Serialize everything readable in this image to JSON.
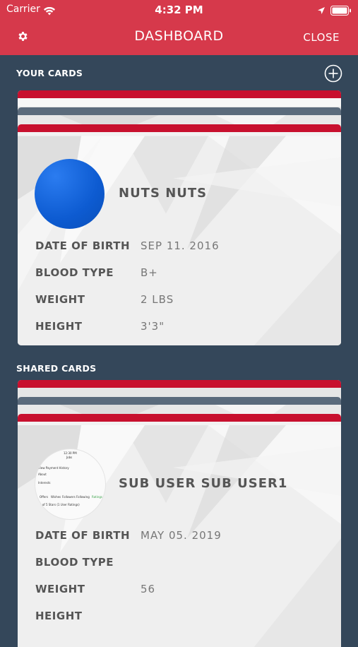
{
  "status_bar": {
    "carrier": "Carrier",
    "time": "4:32 PM"
  },
  "nav": {
    "title": "DASHBOARD",
    "close_label": "CLOSE"
  },
  "your_cards": {
    "section_title": "YOUR CARDS",
    "card": {
      "name": "NUTS NUTS",
      "fields": [
        {
          "label": "DATE OF BIRTH",
          "value": "SEP 11. 2016"
        },
        {
          "label": "BLOOD TYPE",
          "value": "B+"
        },
        {
          "label": "WEIGHT",
          "value": "2 LBS"
        },
        {
          "label": "HEIGHT",
          "value": "3'3\""
        }
      ]
    }
  },
  "shared_cards": {
    "section_title": "SHARED CARDS",
    "card": {
      "name": "SUB USER SUB USER1",
      "avatar_lines": [
        "12:30 PM",
        "Jobs",
        "View Payment History",
        "About",
        "Interests",
        "Offers",
        "Wishes",
        "Followers",
        "Following",
        "Ratings",
        "1 of 5 Stars (1 User Ratings)"
      ],
      "fields": [
        {
          "label": "DATE OF BIRTH",
          "value": "MAY 05. 2019"
        },
        {
          "label": "BLOOD TYPE",
          "value": ""
        },
        {
          "label": "WEIGHT",
          "value": "56"
        },
        {
          "label": "HEIGHT",
          "value": ""
        }
      ]
    }
  },
  "colors": {
    "nav_red": "#d6394b",
    "card_stripe_red": "#c8102e",
    "background_slate": "#34475a",
    "avatar_blue": "#0d5bd1"
  },
  "icons": [
    "wifi-icon",
    "location-arrow-icon",
    "battery-icon",
    "gear-icon",
    "add-circle-icon"
  ]
}
